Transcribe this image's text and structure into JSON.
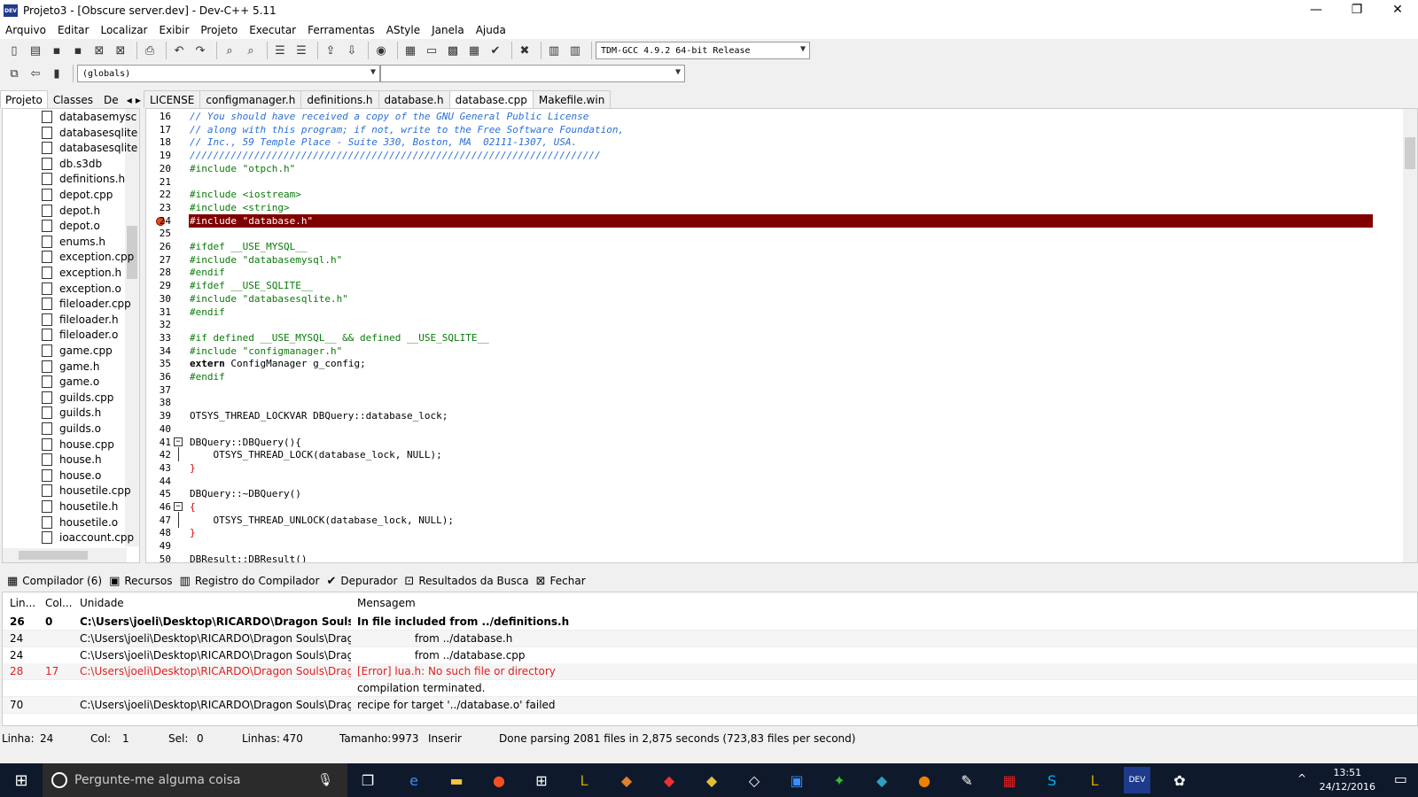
{
  "window": {
    "title": "Projeto3 - [Obscure server.dev] - Dev-C++ 5.11",
    "icon_text": "DEV"
  },
  "menu": [
    "Arquivo",
    "Editar",
    "Localizar",
    "Exibir",
    "Projeto",
    "Executar",
    "Ferramentas",
    "AStyle",
    "Janela",
    "Ajuda"
  ],
  "toolbar": {
    "compiler": "TDM-GCC 4.9.2 64-bit Release",
    "scope": "(globals)"
  },
  "left_tabs": [
    "Projeto",
    "Classes",
    "De"
  ],
  "files": [
    "databasemysc",
    "databasesqlite",
    "databasesqlite",
    "db.s3db",
    "definitions.h",
    "depot.cpp",
    "depot.h",
    "depot.o",
    "enums.h",
    "exception.cpp",
    "exception.h",
    "exception.o",
    "fileloader.cpp",
    "fileloader.h",
    "fileloader.o",
    "game.cpp",
    "game.h",
    "game.o",
    "guilds.cpp",
    "guilds.h",
    "guilds.o",
    "house.cpp",
    "house.h",
    "house.o",
    "housetile.cpp",
    "housetile.h",
    "housetile.o",
    "ioaccount.cpp"
  ],
  "editor_tabs": [
    "LICENSE",
    "configmanager.h",
    "definitions.h",
    "database.h",
    "database.cpp",
    "Makefile.win"
  ],
  "active_editor_tab": "database.cpp",
  "code": [
    {
      "n": "16",
      "t": "// You should have received a copy of the GNU General Public License",
      "c": "cm"
    },
    {
      "n": "17",
      "t": "// along with this program; if not, write to the Free Software Foundation,",
      "c": "cm"
    },
    {
      "n": "18",
      "t": "// Inc., 59 Temple Place - Suite 330, Boston, MA  02111-1307, USA.",
      "c": "cm"
    },
    {
      "n": "19",
      "t": "//////////////////////////////////////////////////////////////////////",
      "c": "cm"
    },
    {
      "n": "20",
      "t": "#include \"otpch.h\"",
      "c": "pp"
    },
    {
      "n": "21",
      "t": "",
      "c": ""
    },
    {
      "n": "22",
      "t": "#include <iostream>",
      "c": "pp"
    },
    {
      "n": "23",
      "t": "#include <string>",
      "c": "pp"
    },
    {
      "n": "24",
      "t": "#include \"database.h\"",
      "c": "hl"
    },
    {
      "n": "25",
      "t": "",
      "c": ""
    },
    {
      "n": "26",
      "t": "#ifdef __USE_MYSQL__",
      "c": "pp"
    },
    {
      "n": "27",
      "t": "#include \"databasemysql.h\"",
      "c": "pp"
    },
    {
      "n": "28",
      "t": "#endif",
      "c": "pp"
    },
    {
      "n": "29",
      "t": "#ifdef __USE_SQLITE__",
      "c": "pp"
    },
    {
      "n": "30",
      "t": "#include \"databasesqlite.h\"",
      "c": "pp"
    },
    {
      "n": "31",
      "t": "#endif",
      "c": "pp"
    },
    {
      "n": "32",
      "t": "",
      "c": ""
    },
    {
      "n": "33",
      "t": "#if defined __USE_MYSQL__ && defined __USE_SQLITE__",
      "c": "pp"
    },
    {
      "n": "34",
      "t": "#include \"configmanager.h\"",
      "c": "pp"
    },
    {
      "n": "35",
      "t": "extern ConfigManager g_config;",
      "c": "ext"
    },
    {
      "n": "36",
      "t": "#endif",
      "c": "pp"
    },
    {
      "n": "37",
      "t": "",
      "c": ""
    },
    {
      "n": "38",
      "t": "",
      "c": ""
    },
    {
      "n": "39",
      "t": "OTSYS_THREAD_LOCKVAR DBQuery::database_lock;",
      "c": "plain"
    },
    {
      "n": "40",
      "t": "",
      "c": ""
    },
    {
      "n": "41",
      "t": "DBQuery::DBQuery(){",
      "c": "plain"
    },
    {
      "n": "42",
      "t": "    OTSYS_THREAD_LOCK(database_lock, NULL);",
      "c": "plain"
    },
    {
      "n": "43",
      "t": "}",
      "c": "sy"
    },
    {
      "n": "44",
      "t": "",
      "c": ""
    },
    {
      "n": "45",
      "t": "DBQuery::~DBQuery()",
      "c": "plain"
    },
    {
      "n": "46",
      "t": "{",
      "c": "sy"
    },
    {
      "n": "47",
      "t": "    OTSYS_THREAD_UNLOCK(database_lock, NULL);",
      "c": "plain"
    },
    {
      "n": "48",
      "t": "}",
      "c": "sy"
    },
    {
      "n": "49",
      "t": "",
      "c": ""
    },
    {
      "n": "50",
      "t": "DBResult::DBResult()",
      "c": "plain"
    }
  ],
  "bottom_tabs": [
    {
      "icon": "▦",
      "label": "Compilador (6)"
    },
    {
      "icon": "▣",
      "label": "Recursos"
    },
    {
      "icon": "▥",
      "label": "Registro do Compilador"
    },
    {
      "icon": "✔",
      "label": "Depurador"
    },
    {
      "icon": "⊡",
      "label": "Resultados da Busca"
    },
    {
      "icon": "⊠",
      "label": "Fechar"
    }
  ],
  "messages": {
    "headers": {
      "line": "Lin...",
      "col": "Col...",
      "unit": "Unidade",
      "message": "Mensagem"
    },
    "rows": [
      {
        "line": "26",
        "col": "0",
        "unit": "C:\\Users\\joeli\\Desktop\\RICARDO\\Dragon Souls\\Drag...",
        "msg": "In file included from ../definitions.h",
        "style": "bold"
      },
      {
        "line": "24",
        "col": "",
        "unit": "C:\\Users\\joeli\\Desktop\\RICARDO\\Dragon Souls\\Dragon ...",
        "msg": "                 from ../database.h",
        "style": ""
      },
      {
        "line": "24",
        "col": "",
        "unit": "C:\\Users\\joeli\\Desktop\\RICARDO\\Dragon Souls\\Dragon ...",
        "msg": "                 from ../database.cpp",
        "style": ""
      },
      {
        "line": "28",
        "col": "17",
        "unit": "C:\\Users\\joeli\\Desktop\\RICARDO\\Dragon Souls\\Dragon ...",
        "msg": "[Error] lua.h: No such file or directory",
        "style": "err"
      },
      {
        "line": "",
        "col": "",
        "unit": "",
        "msg": "compilation terminated.",
        "style": ""
      },
      {
        "line": "70",
        "col": "",
        "unit": "C:\\Users\\joeli\\Desktop\\RICARDO\\Dragon Souls\\Dragon ...",
        "msg": "recipe for target '../database.o' failed",
        "style": ""
      }
    ]
  },
  "status": {
    "linha_label": "Linha:",
    "linha": "24",
    "col_label": "Col:",
    "col": "1",
    "sel_label": "Sel:",
    "sel": "0",
    "linhas_label": "Linhas:",
    "linhas": "470",
    "tamanho_label": "Tamanho:",
    "tamanho": "9973",
    "mode": "Inserir",
    "message": "Done parsing 2081 files in 2,875 seconds (723,83 files per second)"
  },
  "taskbar": {
    "search_placeholder": "Pergunte-me alguma coisa",
    "time": "13:51",
    "date": "24/12/2016"
  }
}
